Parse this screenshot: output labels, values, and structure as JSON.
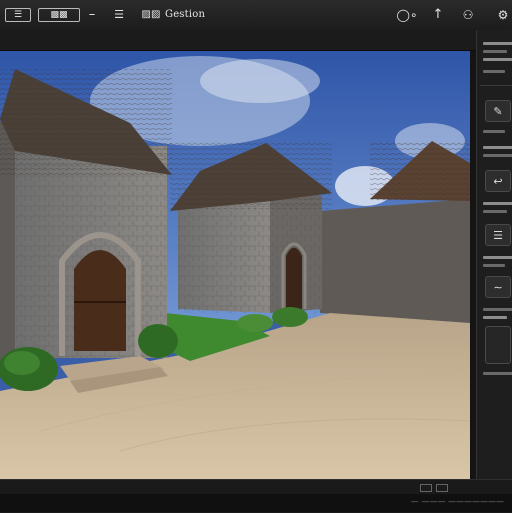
{
  "toolbar": {
    "app_label": "Gestion",
    "buttons": [
      {
        "name": "menu-button",
        "icon": "menu-icon"
      },
      {
        "name": "panel-button",
        "icon": "panel-icon"
      },
      {
        "name": "collapse-button",
        "icon": "dash-icon"
      },
      {
        "name": "list-button",
        "icon": "list-icon"
      }
    ],
    "right_icons": [
      {
        "name": "search-button",
        "icon": "search-icon"
      },
      {
        "name": "pointer-button",
        "icon": "arrow-up-icon"
      },
      {
        "name": "figure-button",
        "icon": "person-icon"
      },
      {
        "name": "settings-button",
        "icon": "gear-icon"
      }
    ]
  },
  "viewport": {
    "scene": "3d-render-stone-gatehouse-and-courtyard",
    "colors": {
      "sky": "#3e66b6",
      "ground": "#cdb89a",
      "grass": "#3f8a2e",
      "stone": "#777"
    }
  },
  "right_panel": {
    "sections": [
      {
        "icon": "pencil-icon"
      },
      {
        "icon": "hook-icon"
      },
      {
        "icon": "stack-icon"
      },
      {
        "icon": "wave-icon"
      }
    ]
  },
  "status": {
    "text": "—  ———  ———————"
  }
}
